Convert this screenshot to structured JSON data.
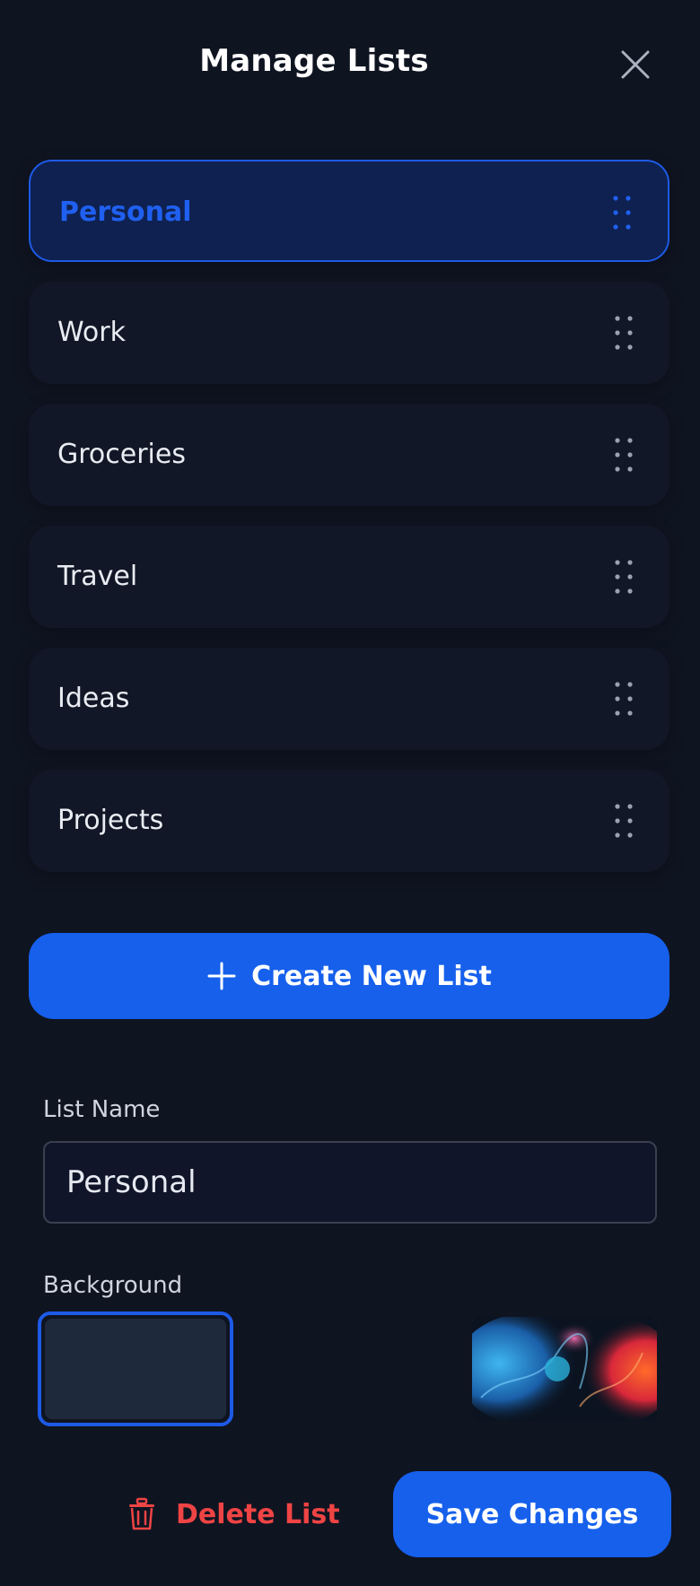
{
  "header": {
    "title": "Manage Lists",
    "close_icon": "close-icon"
  },
  "lists": {
    "selected_index": 0,
    "items": [
      {
        "label": "Personal"
      },
      {
        "label": "Work"
      },
      {
        "label": "Groceries"
      },
      {
        "label": "Travel"
      },
      {
        "label": "Ideas"
      },
      {
        "label": "Projects"
      }
    ],
    "handle_icon": "drag-handle-icon"
  },
  "create": {
    "label": "Create New List",
    "icon": "plus-icon"
  },
  "form": {
    "name_label": "List Name",
    "name_value": "Personal",
    "background_label": "Background",
    "background_options": [
      {
        "type": "color",
        "color": "#1e293b",
        "selected": true
      },
      {
        "type": "image",
        "selected": false
      }
    ]
  },
  "actions": {
    "delete_label": "Delete List",
    "delete_icon": "trash-icon",
    "save_label": "Save Changes"
  },
  "colors": {
    "background": "#0f1421",
    "accent": "#1660ec",
    "danger": "#ef4444",
    "selected_item_bg": "#0f2150"
  }
}
